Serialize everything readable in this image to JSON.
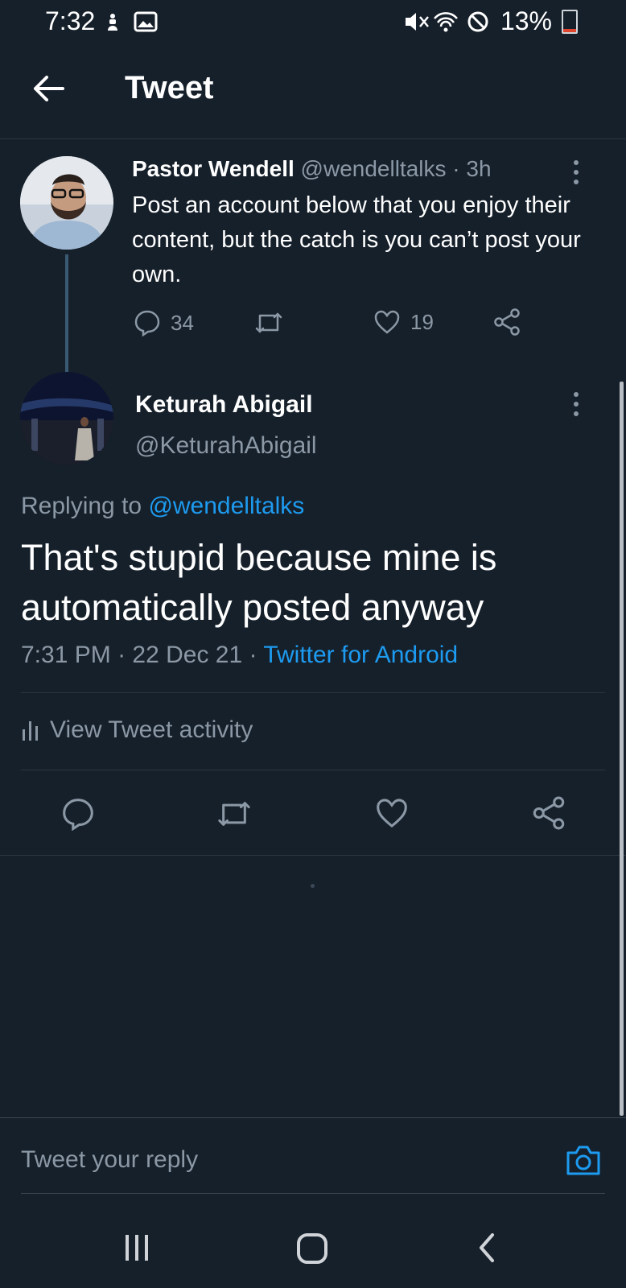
{
  "status_bar": {
    "time": "7:32",
    "battery_percent": "13%"
  },
  "header": {
    "title": "Tweet"
  },
  "original_tweet": {
    "display_name": "Pastor Wendell",
    "handle": "@wendelltalks",
    "separator": "·",
    "age": "3h",
    "text": "Post an account below that you enjoy their content, but the catch is you can’t post your own.",
    "reply_count": "34",
    "like_count": "19"
  },
  "reply_tweet": {
    "display_name": "Keturah Abigail",
    "handle": "@KeturahAbigail",
    "replying_prefix": "Replying to",
    "replying_to": "@wendelltalks",
    "text": "That's stupid because mine is automatically posted anyway",
    "time": "7:31 PM",
    "date": "22 Dec 21",
    "separator": "·",
    "source": "Twitter for Android"
  },
  "activity": {
    "label": "View Tweet activity"
  },
  "reply_box": {
    "placeholder": "Tweet your reply"
  },
  "colors": {
    "background": "#16202b",
    "link": "#1d9bf0",
    "muted": "#8b98a5",
    "divider": "#2b3642"
  }
}
